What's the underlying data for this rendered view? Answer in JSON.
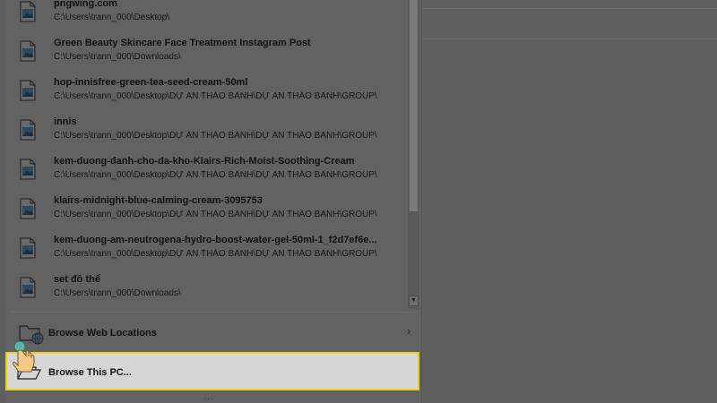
{
  "recent_files": [
    {
      "title": "pngwing.com",
      "path": "C:\\Users\\trann_000\\Desktop\\"
    },
    {
      "title": "Green Beauty Skincare Face Treatment Instagram Post",
      "path": "C:\\Users\\trann_000\\Downloads\\"
    },
    {
      "title": "hop-innisfree-green-tea-seed-cream-50ml",
      "path": "C:\\Users\\trann_000\\Desktop\\DỰ ÁN THẢO BÀNH\\DỰ ÁN THẢO BÀNH\\GROUP\\"
    },
    {
      "title": "innis",
      "path": "C:\\Users\\trann_000\\Desktop\\DỰ ÁN THẢO BÀNH\\DỰ ÁN THẢO BÀNH\\GROUP\\"
    },
    {
      "title": "kem-duong-danh-cho-da-kho-Klairs-Rich-Moist-Soothing-Cream",
      "path": "C:\\Users\\trann_000\\Desktop\\DỰ ÁN THẢO BÀNH\\DỰ ÁN THẢO BÀNH\\GROUP\\"
    },
    {
      "title": "klairs-midnight-blue-calming-cream-3095753",
      "path": "C:\\Users\\trann_000\\Desktop\\DỰ ÁN THẢO BÀNH\\DỰ ÁN THẢO BÀNH\\GROUP\\"
    },
    {
      "title": "kem-duong-am-neutrogena-hydro-boost-water-gel-50ml-1_f2d7ef6e...",
      "path": "C:\\Users\\trann_000\\Desktop\\DỰ ÁN THẢO BÀNH\\DỰ ÁN THẢO BÀNH\\GROUP\\"
    },
    {
      "title": "set đồ thể",
      "path": "C:\\Users\\trann_000\\Downloads\\"
    }
  ],
  "browse_web": {
    "label": "Browse Web Locations",
    "icon": "folder-globe-icon"
  },
  "browse_pc": {
    "label": "Browse This PC...",
    "icon": "open-folder-icon"
  },
  "scroll": {
    "down_arrow": "▼"
  },
  "chevron": "›",
  "grip": "...",
  "colors": {
    "highlight_border": "#e8d21a",
    "highlight_fill": "#d6d6d6",
    "dim_background": "#5f5f5f"
  }
}
